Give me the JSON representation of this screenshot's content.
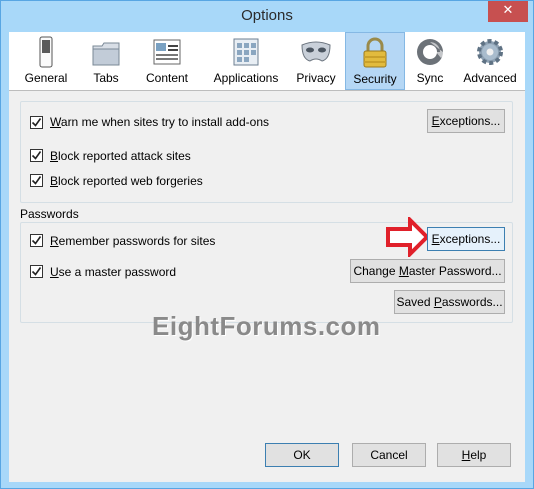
{
  "window": {
    "title": "Options",
    "close_glyph": "✕"
  },
  "tabs": [
    {
      "label": "General",
      "icon": "switch-icon"
    },
    {
      "label": "Tabs",
      "icon": "folder-tabs-icon"
    },
    {
      "label": "Content",
      "icon": "content-page-icon"
    },
    {
      "label": "Applications",
      "icon": "applications-icon"
    },
    {
      "label": "Privacy",
      "icon": "mask-icon"
    },
    {
      "label": "Security",
      "icon": "padlock-icon",
      "active": true
    },
    {
      "label": "Sync",
      "icon": "sync-icon"
    },
    {
      "label": "Advanced",
      "icon": "gear-icon"
    }
  ],
  "addons": {
    "warn": {
      "pre": "",
      "key": "W",
      "post": "arn me when sites try to install add-ons",
      "checked": true
    },
    "exceptions": {
      "key": "E",
      "post": "xceptions..."
    },
    "block_attack": {
      "pre": "",
      "key": "B",
      "post": "lock reported attack sites",
      "checked": true
    },
    "block_forgery": {
      "pre": "",
      "key": "B",
      "post": "lock reported web forgeries",
      "checked": true
    }
  },
  "passwords": {
    "label": "Passwords",
    "remember": {
      "pre": "",
      "key": "R",
      "post": "emember passwords for sites",
      "checked": true
    },
    "exceptions": {
      "key": "E",
      "post": "xceptions..."
    },
    "master": {
      "pre": "",
      "key": "U",
      "post": "se a master password",
      "checked": true
    },
    "change_master": {
      "pre": "Change ",
      "key": "M",
      "post": "aster Password..."
    },
    "saved": {
      "pre": "Saved ",
      "key": "P",
      "post": "asswords..."
    }
  },
  "watermark": "EightForums.com",
  "footer": {
    "ok": "OK",
    "cancel": "Cancel",
    "help": {
      "key": "H",
      "post": "elp"
    }
  },
  "colors": {
    "accent": "#3c7fb1",
    "arrow": "#e0202a",
    "active_tab": "#b5d7f5"
  }
}
